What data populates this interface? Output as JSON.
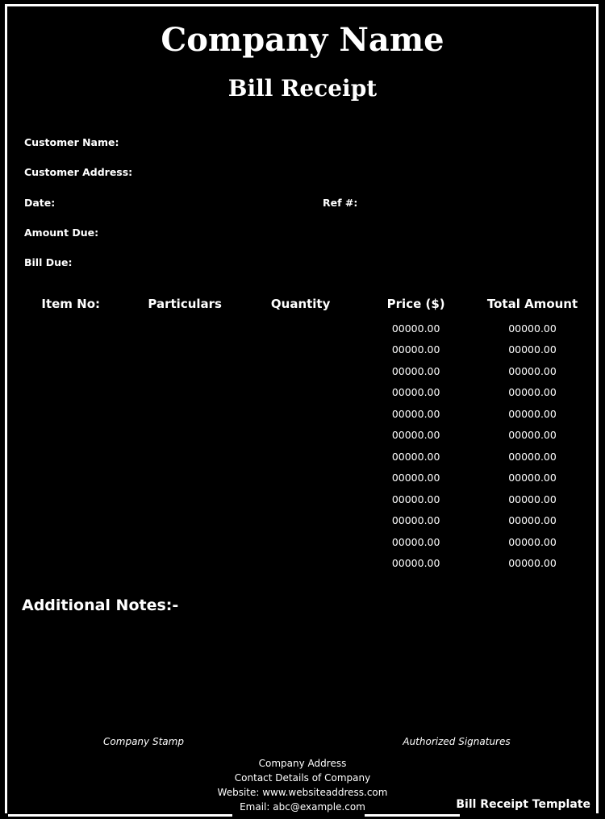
{
  "header": {
    "company_name": "Company Name",
    "title": "Bill Receipt"
  },
  "fields": {
    "customer_name": "Customer Name:",
    "customer_address": "Customer Address:",
    "date": "Date:",
    "ref": "Ref #:",
    "amount_due": "Amount Due:",
    "bill_due": "Bill Due:"
  },
  "table": {
    "columns": [
      "Item No:",
      "Particulars",
      "Quantity",
      "Price ($)",
      "Total Amount"
    ],
    "rows": [
      {
        "item": "",
        "particulars": "",
        "quantity": "",
        "price": "00000.00",
        "total": "00000.00"
      },
      {
        "item": "",
        "particulars": "",
        "quantity": "",
        "price": "00000.00",
        "total": "00000.00"
      },
      {
        "item": "",
        "particulars": "",
        "quantity": "",
        "price": "00000.00",
        "total": "00000.00"
      },
      {
        "item": "",
        "particulars": "",
        "quantity": "",
        "price": "00000.00",
        "total": "00000.00"
      },
      {
        "item": "",
        "particulars": "",
        "quantity": "",
        "price": "00000.00",
        "total": "00000.00"
      },
      {
        "item": "",
        "particulars": "",
        "quantity": "",
        "price": "00000.00",
        "total": "00000.00"
      },
      {
        "item": "",
        "particulars": "",
        "quantity": "",
        "price": "00000.00",
        "total": "00000.00"
      },
      {
        "item": "",
        "particulars": "",
        "quantity": "",
        "price": "00000.00",
        "total": "00000.00"
      },
      {
        "item": "",
        "particulars": "",
        "quantity": "",
        "price": "00000.00",
        "total": "00000.00"
      },
      {
        "item": "",
        "particulars": "",
        "quantity": "",
        "price": "00000.00",
        "total": "00000.00"
      },
      {
        "item": "",
        "particulars": "",
        "quantity": "",
        "price": "00000.00",
        "total": "00000.00"
      },
      {
        "item": "",
        "particulars": "",
        "quantity": "",
        "price": "00000.00",
        "total": "00000.00"
      }
    ]
  },
  "notes": {
    "title": "Additional Notes:-"
  },
  "signatures": {
    "stamp": "Company Stamp",
    "authorized": "Authorized Signatures"
  },
  "footer": {
    "address": "Company Address",
    "contact": "Contact Details of Company",
    "website": "Website: www.websiteaddress.com",
    "email": "Email: abc@example.com"
  },
  "template_label": "Bill Receipt Template",
  "colors": {
    "background": "#000000",
    "foreground": "#ffffff"
  }
}
